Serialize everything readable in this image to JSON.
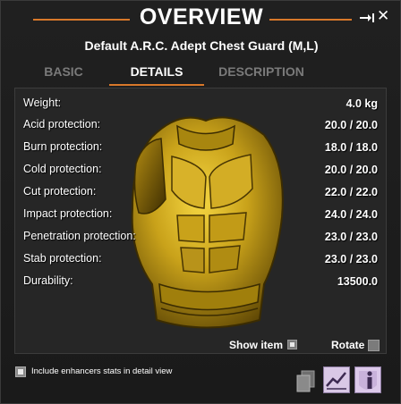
{
  "window": {
    "title": "OVERVIEW",
    "item_name": "Default A.R.C. Adept Chest Guard (M,L)",
    "pin_icon": "pin-icon",
    "close_icon": "close-icon",
    "close_glyph": "✕"
  },
  "tabs": [
    {
      "label": "BASIC",
      "active": false
    },
    {
      "label": "DETAILS",
      "active": true
    },
    {
      "label": "DESCRIPTION",
      "active": false
    }
  ],
  "stats": [
    {
      "label": "Weight:",
      "value": "4.0 kg"
    },
    {
      "label": "Acid protection:",
      "value": "20.0 / 20.0"
    },
    {
      "label": "Burn protection:",
      "value": "18.0 / 18.0"
    },
    {
      "label": "Cold protection:",
      "value": "20.0 / 20.0"
    },
    {
      "label": "Cut protection:",
      "value": "22.0 / 22.0"
    },
    {
      "label": "Impact protection:",
      "value": "24.0 / 24.0"
    },
    {
      "label": "Penetration protection:",
      "value": "23.0 / 23.0"
    },
    {
      "label": "Stab protection:",
      "value": "23.0 / 23.0"
    },
    {
      "label": "Durability:",
      "value": "13500.0"
    }
  ],
  "options": {
    "show_item_label": "Show item",
    "show_item_checked": true,
    "rotate_label": "Rotate",
    "rotate_checked": false
  },
  "footer": {
    "enhancers_label": "Include enhancers stats in detail view",
    "enhancers_checked": true,
    "buttons": [
      "copy-icon",
      "graph-icon",
      "info-icon"
    ]
  },
  "colors": {
    "accent": "#d8782a",
    "armor_gold": "#c9a21a"
  }
}
